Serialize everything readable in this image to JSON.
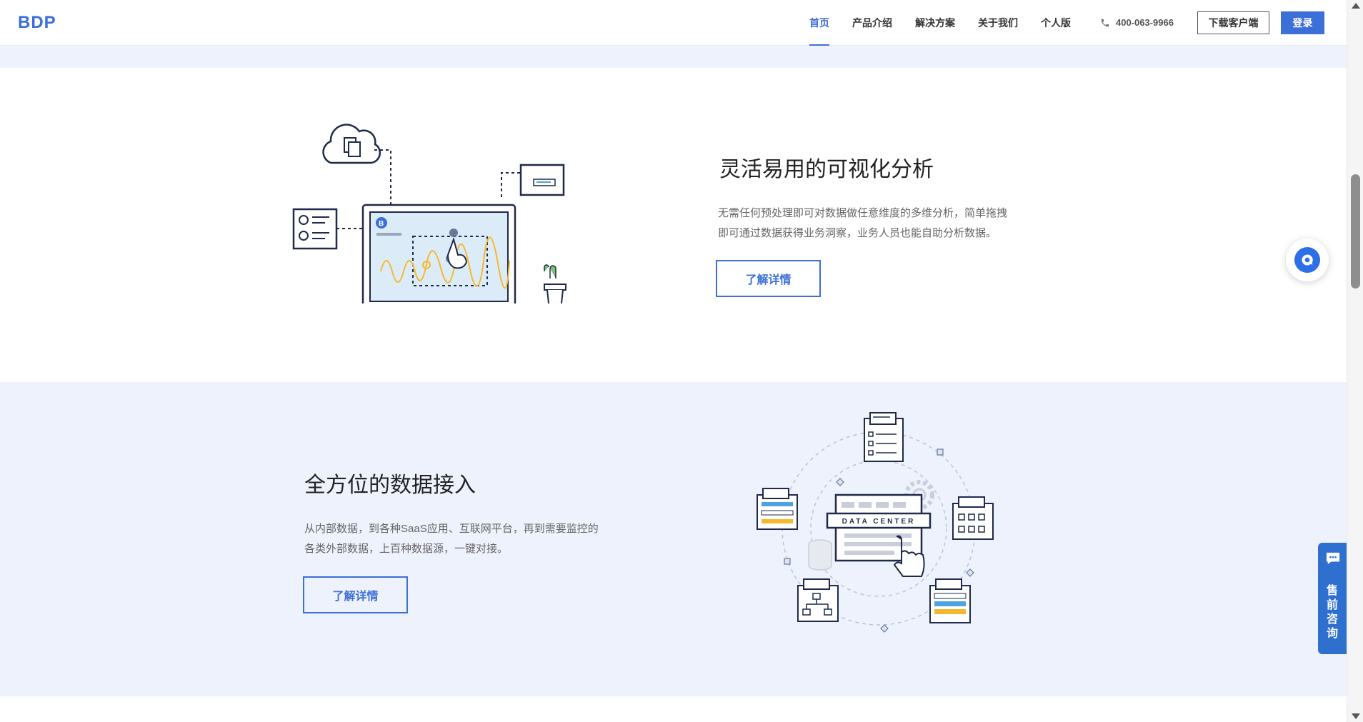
{
  "header": {
    "logo": "BDP",
    "nav": [
      {
        "label": "首页",
        "active": true
      },
      {
        "label": "产品介绍",
        "active": false
      },
      {
        "label": "解决方案",
        "active": false
      },
      {
        "label": "关于我们",
        "active": false
      },
      {
        "label": "个人版",
        "active": false
      }
    ],
    "phone": "400-063-9966",
    "download_label": "下载客户端",
    "login_label": "登录"
  },
  "features": [
    {
      "title": "灵活易用的可视化分析",
      "desc_line1": "无需任何预处理即可对数据做任意维度的多维分析，简单拖拽",
      "desc_line2": "即可通过数据获得业务洞察，业务人员也能自助分析数据。",
      "button": "了解详情",
      "icon": "laptop-analysis-illustration"
    },
    {
      "title": "全方位的数据接入",
      "desc_line1": "从内部数据，到各种SaaS应用、互联网平台，再到需要监控的",
      "desc_line2": "各类外部数据，上百种数据源，一键对接。",
      "button": "了解详情",
      "icon": "data-center-illustration",
      "illustration_label": "DATA CENTER"
    }
  ],
  "widgets": {
    "presale_label": "售前咨询",
    "chat_icon": "chat-icon"
  },
  "colors": {
    "accent": "#3d6fd9",
    "band": "#eef2fc"
  }
}
